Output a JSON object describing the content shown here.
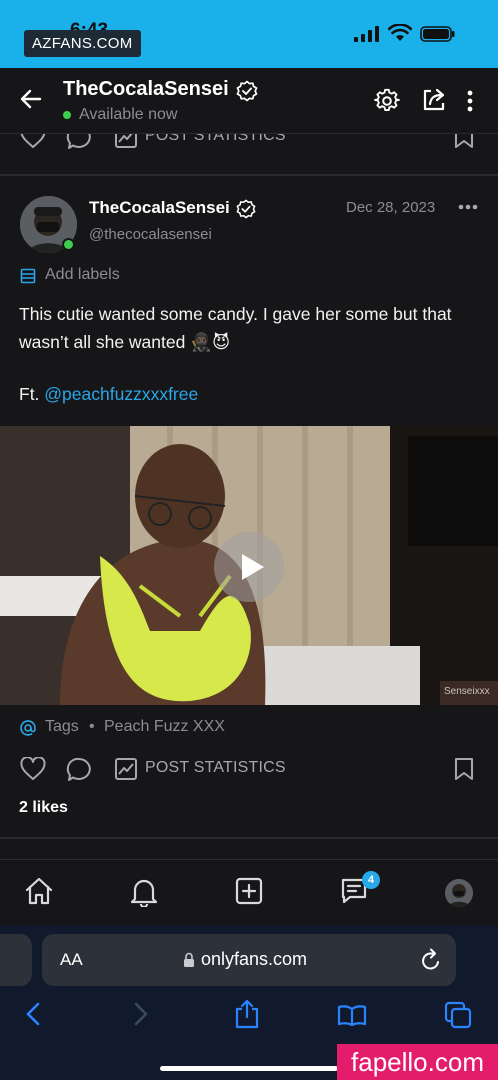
{
  "status_bar": {
    "time": "6:43",
    "watermark": "AZFANS.COM"
  },
  "header": {
    "title": "TheCocalaSensei",
    "status": "Available now"
  },
  "prev_post": {
    "stats_label": "POST STATISTICS"
  },
  "post": {
    "author_name": "TheCocalaSensei",
    "author_handle": "@thecocalasensei",
    "date": "Dec 28, 2023",
    "add_labels": "Add labels",
    "text": "This cutie wanted some candy. I gave her some but that wasn’t all she wanted 🥷🏿😈",
    "ft_prefix": "Ft. ",
    "mention": "@peachfuzzxxxfree",
    "media_watermark": "Senseixxx",
    "tags_label": "Tags",
    "tags_sep": "•",
    "tag_item": "Peach Fuzz XXX",
    "stats_label": "POST STATISTICS",
    "likes": "2 likes"
  },
  "bottom_nav": {
    "messages_badge": "4"
  },
  "safari": {
    "aa": "AA",
    "url": "onlyfans.com"
  },
  "corner_watermark": "fapello.com",
  "colors": {
    "accent": "#27a8e8",
    "online": "#3ccf4e",
    "status_bar": "#1ab0ea"
  }
}
